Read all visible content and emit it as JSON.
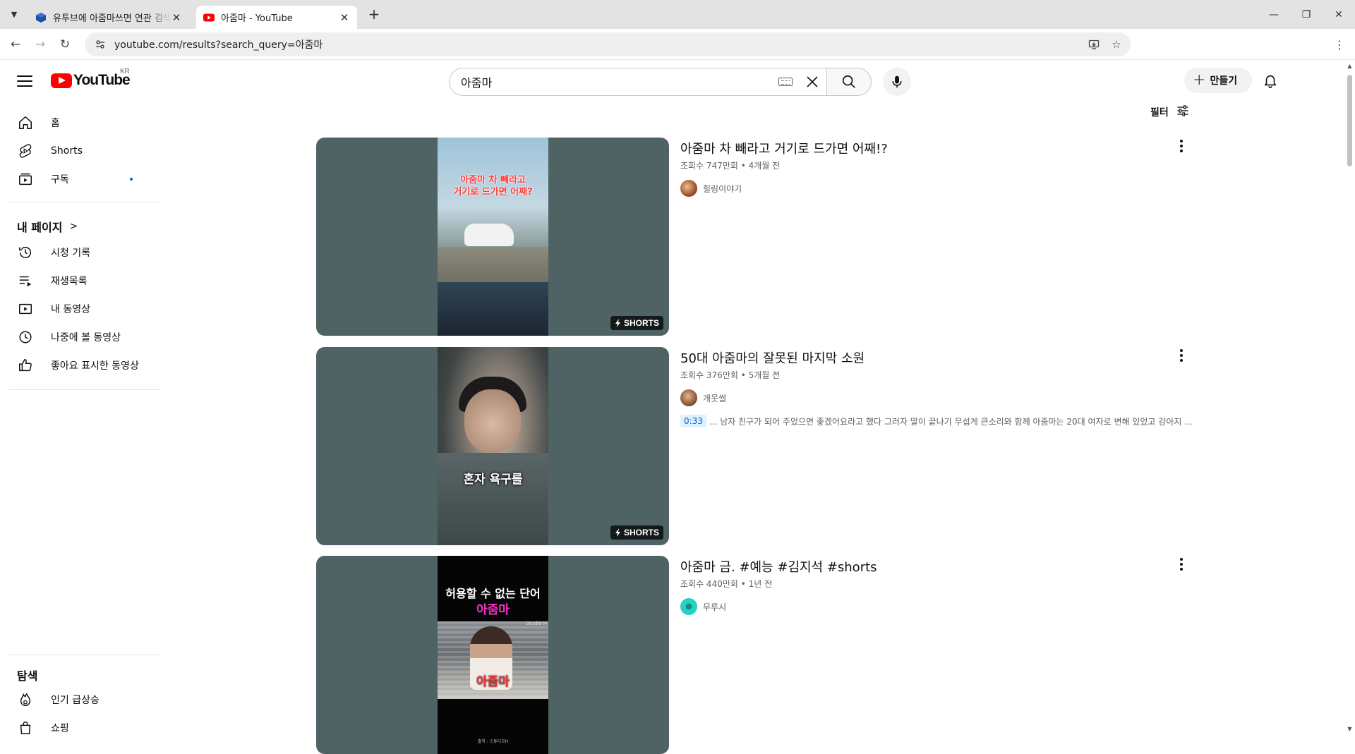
{
  "browser": {
    "tabs": [
      {
        "title": "유투브에 아줌마쓰면 연관 검색어",
        "active": false,
        "icon": "cube-icon"
      },
      {
        "title": "아줌마 - YouTube",
        "active": true,
        "icon": "youtube-icon"
      }
    ],
    "url": "youtube.com/results?search_query=아줌마"
  },
  "masthead": {
    "logo_text": "YouTube",
    "region": "KR",
    "search_query": "아줌마",
    "create_label": "만들기"
  },
  "sidebar": {
    "main": [
      {
        "label": "홈",
        "icon": "home-icon"
      },
      {
        "label": "Shorts",
        "icon": "shorts-icon"
      },
      {
        "label": "구독",
        "icon": "subscriptions-icon",
        "has_dot": true
      }
    ],
    "you_heading": "내 페이지",
    "you_items": [
      {
        "label": "시청 기록",
        "icon": "history-icon"
      },
      {
        "label": "재생목록",
        "icon": "playlist-icon"
      },
      {
        "label": "내 동영상",
        "icon": "my-videos-icon"
      },
      {
        "label": "나중에 볼 동영상",
        "icon": "watch-later-icon"
      },
      {
        "label": "좋아요 표시한 동영상",
        "icon": "like-icon"
      }
    ],
    "explore_heading": "탐색",
    "explore_items": [
      {
        "label": "인기 급상승",
        "icon": "trending-icon"
      },
      {
        "label": "쇼핑",
        "icon": "shopping-icon"
      }
    ]
  },
  "filter_label": "필터",
  "results": [
    {
      "title": "아줌마 차 빼라고 거기로 드가면 어째!?",
      "meta": "조회수 747만회 • 4개월 전",
      "channel": "힐링이야기",
      "badge": "SHORTS",
      "thumb_caption": [
        "아줌마 차 빼라고",
        "거기로 드가면 어째?"
      ],
      "avatar_color": "#a0522d"
    },
    {
      "title": "50대 아줌마의 잘못된 마지막 소원",
      "meta": "조회수 376만회 • 5개월 전",
      "channel": "개웃썰",
      "badge": "SHORTS",
      "thumb_caption": [
        "혼자 욕구를"
      ],
      "snippet_time": "0:33",
      "snippet": "... 남자 친구가 되어 주었으면 좋겠어요라고 했다 그러자 말이 끝나기 무섭게 큰소리와 함께 아줌마는 20대 여자로 변해 있었고 강아지 ...",
      "avatar_color": "#8b5a3c"
    },
    {
      "title": "아줌마 금. #예능 #김지석 #shorts",
      "meta": "조회수 440만회 • 1년 전",
      "channel": "무루시",
      "badge": "",
      "thumb_caption": [
        "허용할 수 없는 단어",
        "아줌마",
        "아줌마"
      ],
      "thumb_small": [
        "Studio H",
        "출처 : 스튜디오H"
      ],
      "avatar_color": "#22d3c5"
    }
  ]
}
